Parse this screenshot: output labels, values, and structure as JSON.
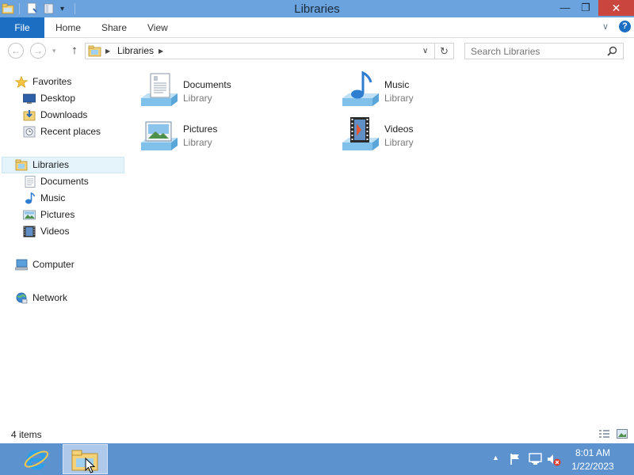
{
  "window": {
    "title": "Libraries",
    "controls": {
      "minimize": "—",
      "restore": "❐",
      "close": "✕"
    }
  },
  "ribbon": {
    "tabs": [
      {
        "label": "File"
      },
      {
        "label": "Home"
      },
      {
        "label": "Share"
      },
      {
        "label": "View"
      }
    ]
  },
  "address": {
    "path": "Libraries",
    "search_placeholder": "Search Libraries"
  },
  "nav": {
    "favorites": {
      "label": "Favorites",
      "items": [
        {
          "label": "Desktop"
        },
        {
          "label": "Downloads"
        },
        {
          "label": "Recent places"
        }
      ]
    },
    "libraries": {
      "label": "Libraries",
      "items": [
        {
          "label": "Documents"
        },
        {
          "label": "Music"
        },
        {
          "label": "Pictures"
        },
        {
          "label": "Videos"
        }
      ]
    },
    "computer": {
      "label": "Computer"
    },
    "network": {
      "label": "Network"
    }
  },
  "content": {
    "tiles": [
      {
        "name": "Documents",
        "type": "Library",
        "icon": "documents-library-icon"
      },
      {
        "name": "Music",
        "type": "Library",
        "icon": "music-library-icon"
      },
      {
        "name": "Pictures",
        "type": "Library",
        "icon": "pictures-library-icon"
      },
      {
        "name": "Videos",
        "type": "Library",
        "icon": "videos-library-icon"
      }
    ]
  },
  "status": {
    "item_count": "4 items"
  },
  "taskbar": {
    "clock_time": "8:01 AM",
    "clock_date": "1/22/2023"
  },
  "colors": {
    "title_bar": "#6aa3de",
    "file_tab": "#1b6ec2",
    "close_button": "#c9453d",
    "taskbar": "#5c93cf",
    "selection": "#e5f3fb"
  }
}
